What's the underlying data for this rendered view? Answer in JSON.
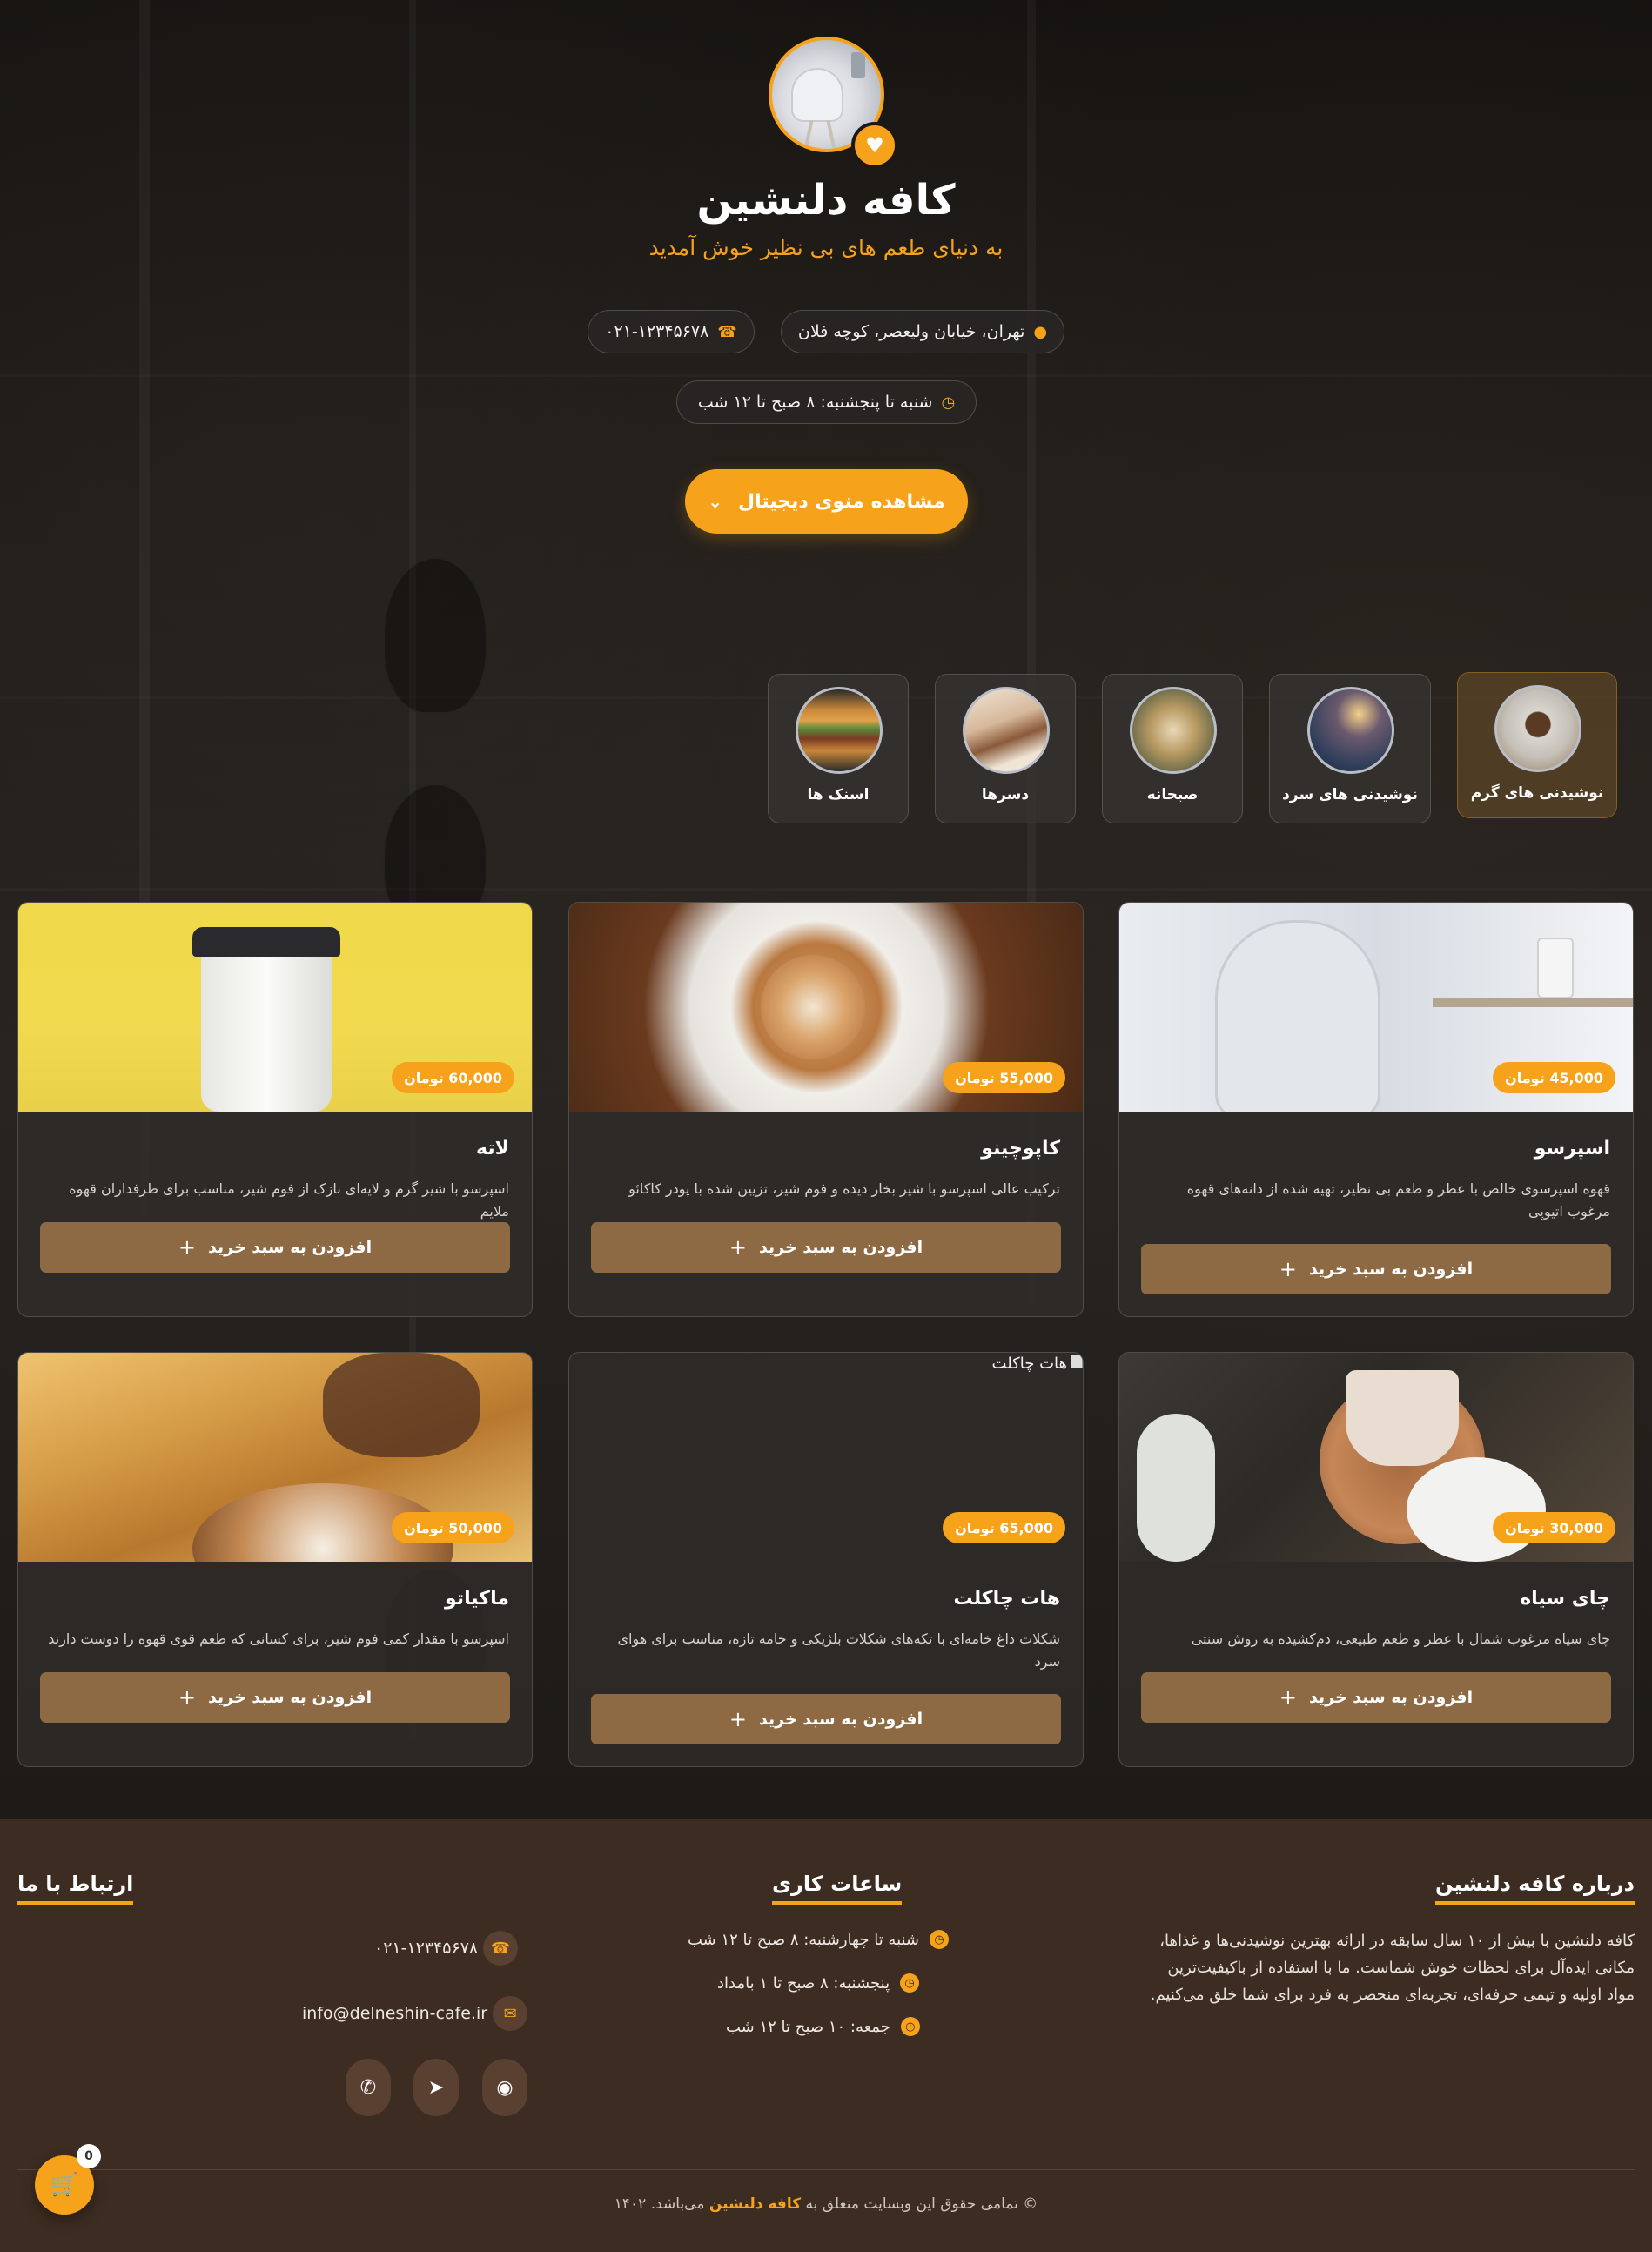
{
  "colors": {
    "accent": "#f7a21b",
    "button_brown": "#8d6a43",
    "footer_bg": "#3d2c21"
  },
  "hero": {
    "title": "کافه دلنشین",
    "subtitle": "به دنیای طعم های بی نظیر خوش آمدید",
    "address": "تهران، خیابان ولیعصر، کوچه فلان",
    "phone": "۰۲۱-۱۲۳۴۵۶۷۸",
    "hours": "شنبه تا پنجشنبه: ۸ صبح تا ۱۲ شب",
    "menu_button": "مشاهده منوی دیجیتال"
  },
  "categories": [
    {
      "label": "نوشیدنی های گرم",
      "icon": "hot-drinks-image"
    },
    {
      "label": "نوشیدنی های سرد",
      "icon": "cold-drinks-image"
    },
    {
      "label": "صبحانه",
      "icon": "breakfast-image"
    },
    {
      "label": "دسرها",
      "icon": "desserts-image"
    },
    {
      "label": "اسنک ها",
      "icon": "snacks-image"
    }
  ],
  "products": [
    {
      "name": "اسپرسو",
      "price": "45,000 تومان",
      "desc": "قهوه اسپرسوی خالص با عطر و طعم بی نظیر، تهیه شده از دانه‌های قهوه مرغوب اتیوپی"
    },
    {
      "name": "کاپوچینو",
      "price": "55,000 تومان",
      "desc": "ترکیب عالی اسپرسو با شیر بخار دیده و فوم شیر، تزیین شده با پودر کاکائو"
    },
    {
      "name": "لاته",
      "price": "60,000 تومان",
      "desc": "اسپرسو با شیر گرم و لایه‌ای نازک از فوم شیر، مناسب برای طرفداران قهوه ملایم"
    },
    {
      "name": "چای سیاه",
      "price": "30,000 تومان",
      "desc": "چای سیاه مرغوب شمال با عطر و طعم طبیعی، دم‌کشیده به روش سنتی"
    },
    {
      "name": "هات چاکلت",
      "price": "65,000 تومان",
      "desc": "شکلات داغ خامه‌ای با تکه‌های شکلات بلژیکی و خامه تازه، مناسب برای هوای سرد",
      "broken_alt": "هات چاکلت"
    },
    {
      "name": "ماکیاتو",
      "price": "50,000 تومان",
      "desc": "اسپرسو با مقدار کمی فوم شیر، برای کسانی که طعم قوی قهوه را دوست دارند"
    }
  ],
  "add_to_cart": "افزودن به سبد خرید",
  "footer": {
    "about_title": "درباره کافه دلنشین",
    "about_text": "کافه دلنشین با بیش از ۱۰ سال سابقه در ارائه بهترین نوشیدنی‌ها و غذاها، مکانی ایده‌آل برای لحظات خوش شماست. ما با استفاده از باکیفیت‌ترین مواد اولیه و تیمی حرفه‌ای، تجربه‌ای منحصر به فرد برای شما خلق می‌کنیم.",
    "hours_title": "ساعات کاری",
    "hours": [
      "شنبه تا چهارشنبه: ۸ صبح تا ۱۲ شب",
      "پنجشنبه: ۸ صبح تا ۱ بامداد",
      "جمعه: ۱۰ صبح تا ۱۲ شب"
    ],
    "contact_title": "ارتباط با ما",
    "phone": "۰۲۱-۱۲۳۴۵۶۷۸",
    "email": "info@delneshin-cafe.ir",
    "social": [
      "instagram-icon",
      "telegram-icon",
      "whatsapp-icon"
    ],
    "copyright_pre": "© تمامی حقوق این وبسایت متعلق به",
    "copyright_brand": "کافه دلنشین",
    "copyright_post": "می‌باشد. ۱۴۰۲"
  },
  "cart": {
    "count": "0"
  }
}
